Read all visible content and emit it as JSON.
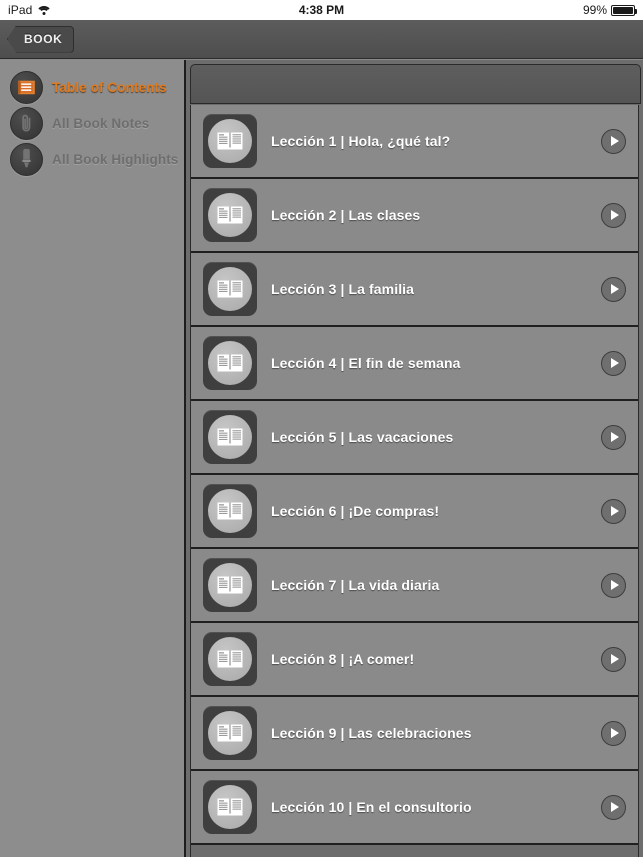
{
  "status_bar": {
    "device": "iPad",
    "wifi_icon": "wifi-icon",
    "time": "4:38 PM",
    "battery_percent": "99%",
    "battery_icon": "battery-full-icon"
  },
  "navbar": {
    "back_label": "BOOK",
    "back_icon": "chevron-left-icon"
  },
  "sidebar": {
    "items": [
      {
        "label": "Table of Contents",
        "icon": "book-icon",
        "active": true
      },
      {
        "label": "All Book Notes",
        "icon": "paperclip-icon",
        "active": false
      },
      {
        "label": "All Book Highlights",
        "icon": "highlighter-icon",
        "active": false
      }
    ]
  },
  "content": {
    "header_title": "",
    "rows": [
      {
        "label": "Lección 1 | Hola, ¿qué tal?",
        "icon": "open-book-icon",
        "action_icon": "play-icon"
      },
      {
        "label": "Lección 2 | Las clases",
        "icon": "open-book-icon",
        "action_icon": "play-icon"
      },
      {
        "label": "Lección 3 | La familia",
        "icon": "open-book-icon",
        "action_icon": "play-icon"
      },
      {
        "label": "Lección 4 | El fin de semana",
        "icon": "open-book-icon",
        "action_icon": "play-icon"
      },
      {
        "label": "Lección 5 | Las vacaciones",
        "icon": "open-book-icon",
        "action_icon": "play-icon"
      },
      {
        "label": "Lección 6 | ¡De compras!",
        "icon": "open-book-icon",
        "action_icon": "play-icon"
      },
      {
        "label": "Lección 7 | La vida diaria",
        "icon": "open-book-icon",
        "action_icon": "play-icon"
      },
      {
        "label": "Lección 8 | ¡A comer!",
        "icon": "open-book-icon",
        "action_icon": "play-icon"
      },
      {
        "label": "Lección 9 | Las celebraciones",
        "icon": "open-book-icon",
        "action_icon": "play-icon"
      },
      {
        "label": "Lección 10 | En el consultorio",
        "icon": "open-book-icon",
        "action_icon": "play-icon"
      }
    ]
  },
  "colors": {
    "accent_orange": "#e07a1e",
    "row_background": "#8a8a8a",
    "sidebar_background": "#8d8d8d",
    "panel_background": "#6d6d6d",
    "divider": "#1f1f1f",
    "icon_tile": "#3f3f3f"
  }
}
